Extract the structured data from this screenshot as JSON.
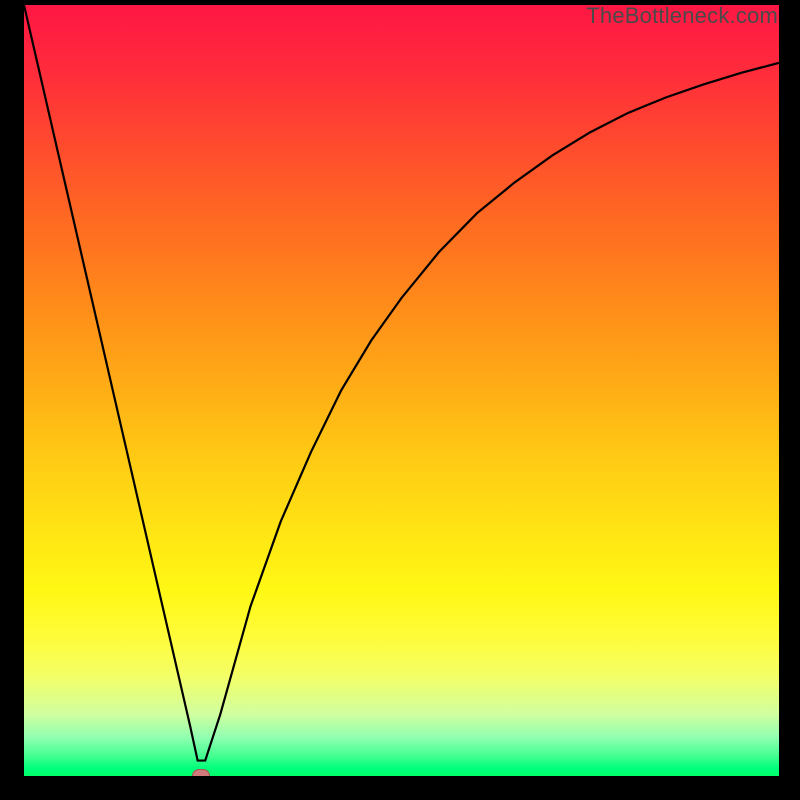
{
  "watermark": "TheBottleneck.com",
  "colors": {
    "background": "#000000",
    "curve": "#000000",
    "marker": "#d07a7a"
  },
  "chart_data": {
    "type": "line",
    "title": "",
    "xlabel": "",
    "ylabel": "",
    "xlim": [
      0,
      100
    ],
    "ylim": [
      0,
      100
    ],
    "series": [
      {
        "name": "bottleneck-curve",
        "x": [
          0,
          2,
          4,
          6,
          8,
          10,
          12,
          14,
          16,
          18,
          20,
          22,
          23,
          24,
          26,
          28,
          30,
          34,
          38,
          42,
          46,
          50,
          55,
          60,
          65,
          70,
          75,
          80,
          85,
          90,
          95,
          100
        ],
        "values": [
          100,
          91.5,
          83,
          74.5,
          66,
          57.5,
          49,
          40.5,
          32,
          23.5,
          15,
          6.5,
          2,
          2,
          8,
          15,
          22,
          33,
          42,
          50,
          56.5,
          62,
          68,
          73,
          77,
          80.5,
          83.5,
          86,
          88,
          89.7,
          91.2,
          92.5
        ]
      }
    ],
    "marker": {
      "x": 23.5,
      "y": 0
    },
    "background_gradient": {
      "top": "#ff1744",
      "upper_mid": "#ffa816",
      "lower_mid": "#fff814",
      "bottom": "#00ff6a"
    }
  }
}
